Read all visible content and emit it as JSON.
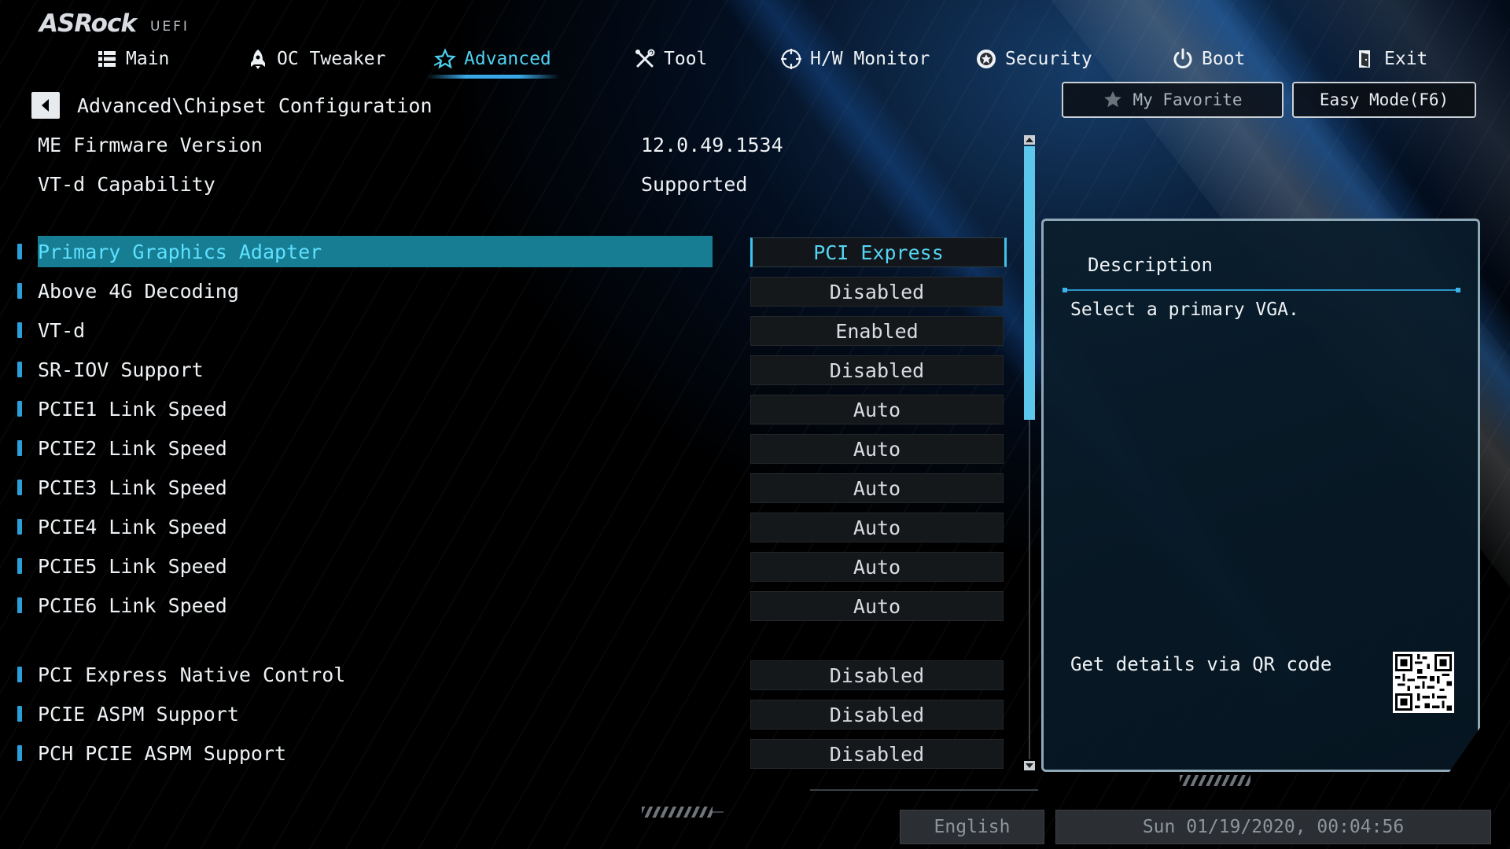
{
  "app": {
    "logo_brand": "ASRock",
    "logo_sub": "UEFI"
  },
  "nav": {
    "tabs": [
      {
        "label": "Main",
        "icon": "list-icon"
      },
      {
        "label": "OC Tweaker",
        "icon": "rocket-icon"
      },
      {
        "label": "Advanced",
        "icon": "star-icon"
      },
      {
        "label": "Tool",
        "icon": "tools-icon"
      },
      {
        "label": "H/W Monitor",
        "icon": "crosshair-icon"
      },
      {
        "label": "Security",
        "icon": "shield-icon"
      },
      {
        "label": "Boot",
        "icon": "power-icon"
      },
      {
        "label": "Exit",
        "icon": "exit-door-icon"
      }
    ],
    "active_tab": "Advanced"
  },
  "breadcrumb": {
    "path": "Advanced\\Chipset Configuration"
  },
  "buttons": {
    "favorite": "My Favorite",
    "easy_mode": "Easy Mode(F6)"
  },
  "info": [
    {
      "label": "ME Firmware Version",
      "value": "12.0.49.1534"
    },
    {
      "label": "VT-d Capability",
      "value": "Supported"
    }
  ],
  "options": [
    {
      "label": "Primary Graphics Adapter",
      "value": "PCI Express",
      "selected": true
    },
    {
      "label": "Above 4G Decoding",
      "value": "Disabled"
    },
    {
      "label": "VT-d",
      "value": "Enabled"
    },
    {
      "label": "SR-IOV Support",
      "value": "Disabled"
    },
    {
      "label": "PCIE1 Link Speed",
      "value": "Auto"
    },
    {
      "label": "PCIE2 Link Speed",
      "value": "Auto"
    },
    {
      "label": "PCIE3 Link Speed",
      "value": "Auto"
    },
    {
      "label": "PCIE4 Link Speed",
      "value": "Auto"
    },
    {
      "label": "PCIE5 Link Speed",
      "value": "Auto"
    },
    {
      "label": "PCIE6 Link Speed",
      "value": "Auto"
    },
    {
      "label": "PCI Express Native Control",
      "value": "Disabled"
    },
    {
      "label": "PCIE ASPM Support",
      "value": "Disabled"
    },
    {
      "label": "PCH PCIE ASPM Support",
      "value": "Disabled"
    }
  ],
  "description": {
    "title": "Description",
    "text": "Select a primary VGA.",
    "qr_label": "Get details via QR code"
  },
  "footer": {
    "language": "English",
    "datetime": "Sun 01/19/2020, 00:04:56"
  },
  "colors": {
    "accent": "#4fd0f0",
    "selected_row": "#177d93",
    "bullet": "#2a9fd8",
    "scroll_thumb": "#5cc7ea"
  }
}
